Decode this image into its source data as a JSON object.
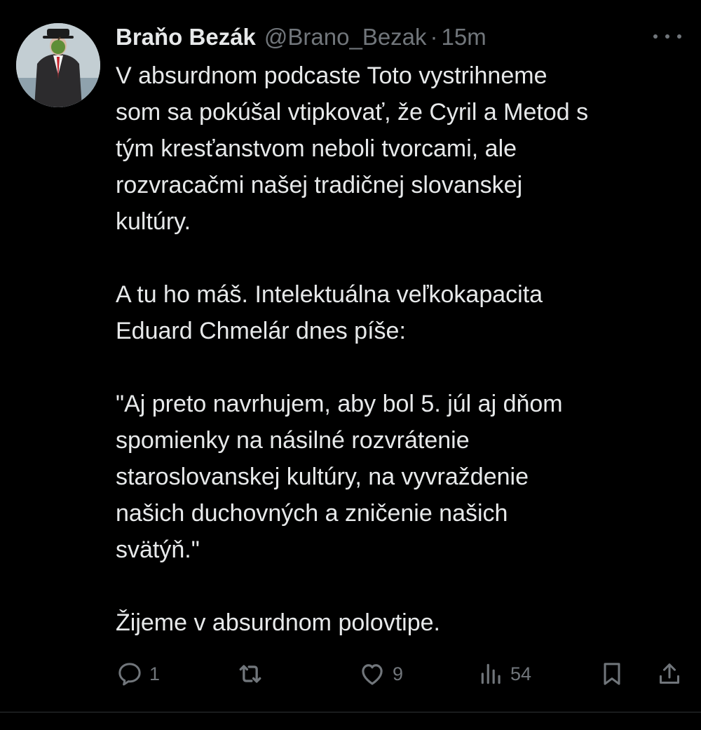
{
  "tweet": {
    "author_name": "Braňo Bezák",
    "handle": "@Brano_Bezak",
    "separator": "·",
    "time": "15m",
    "paragraphs": [
      [
        "V absurdnom podcaste Toto vystrihneme",
        "som sa pokúšal vtipkovať, že Cyril a Metod s",
        "tým kresťanstvom neboli tvorcami, ale",
        "rozvracačmi našej tradičnej slovanskej",
        "kultúry."
      ],
      [
        "A tu ho máš. Intelektuálna veľkokapacita",
        "Eduard Chmelár dnes píše:"
      ],
      [
        "\"Aj preto navrhujem, aby bol 5. júl aj dňom",
        "spomienky na násilné rozvrátenie",
        "staroslovanskej kultúry, na vyvraždenie",
        "našich duchovných a zničenie našich",
        "svätýň.\""
      ],
      [
        "Žijeme v absurdnom polovtipe."
      ]
    ]
  },
  "actions": {
    "reply_count": "1",
    "like_count": "9",
    "views_count": "54"
  },
  "icons": {
    "reply": "reply-icon",
    "retweet": "retweet-icon",
    "like": "heart-icon",
    "views": "views-icon",
    "bookmark": "bookmark-icon",
    "share": "share-icon",
    "more": "more-icon"
  },
  "colors": {
    "background": "#000000",
    "text": "#e7e9ea",
    "muted": "#71767b"
  }
}
